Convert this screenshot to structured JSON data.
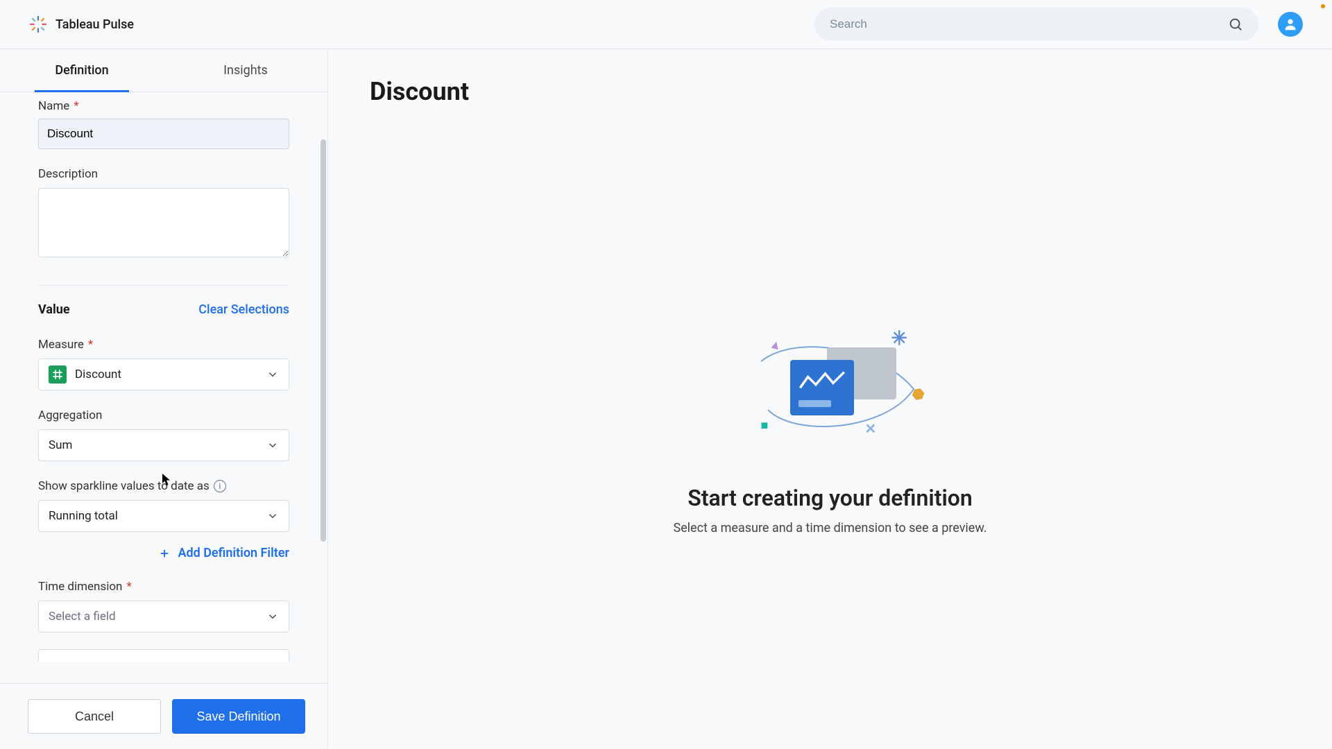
{
  "brand": {
    "name": "Tableau Pulse"
  },
  "search": {
    "placeholder": "Search"
  },
  "tabs": {
    "definition": "Definition",
    "insights": "Insights"
  },
  "form": {
    "name_label": "Name",
    "name_value": "Discount",
    "description_label": "Description",
    "description_value": "",
    "value_section": "Value",
    "clear_selections": "Clear Selections",
    "measure_label": "Measure",
    "measure_value": "Discount",
    "aggregation_label": "Aggregation",
    "aggregation_value": "Sum",
    "sparkline_label": "Show sparkline values to date as",
    "sparkline_value": "Running total",
    "add_filter": "Add Definition Filter",
    "time_dim_label": "Time dimension",
    "time_dim_placeholder": "Select a field"
  },
  "footer": {
    "cancel": "Cancel",
    "save": "Save Definition"
  },
  "main": {
    "title": "Discount",
    "empty_title": "Start creating your definition",
    "empty_sub": "Select a measure and a time dimension to see a preview."
  }
}
